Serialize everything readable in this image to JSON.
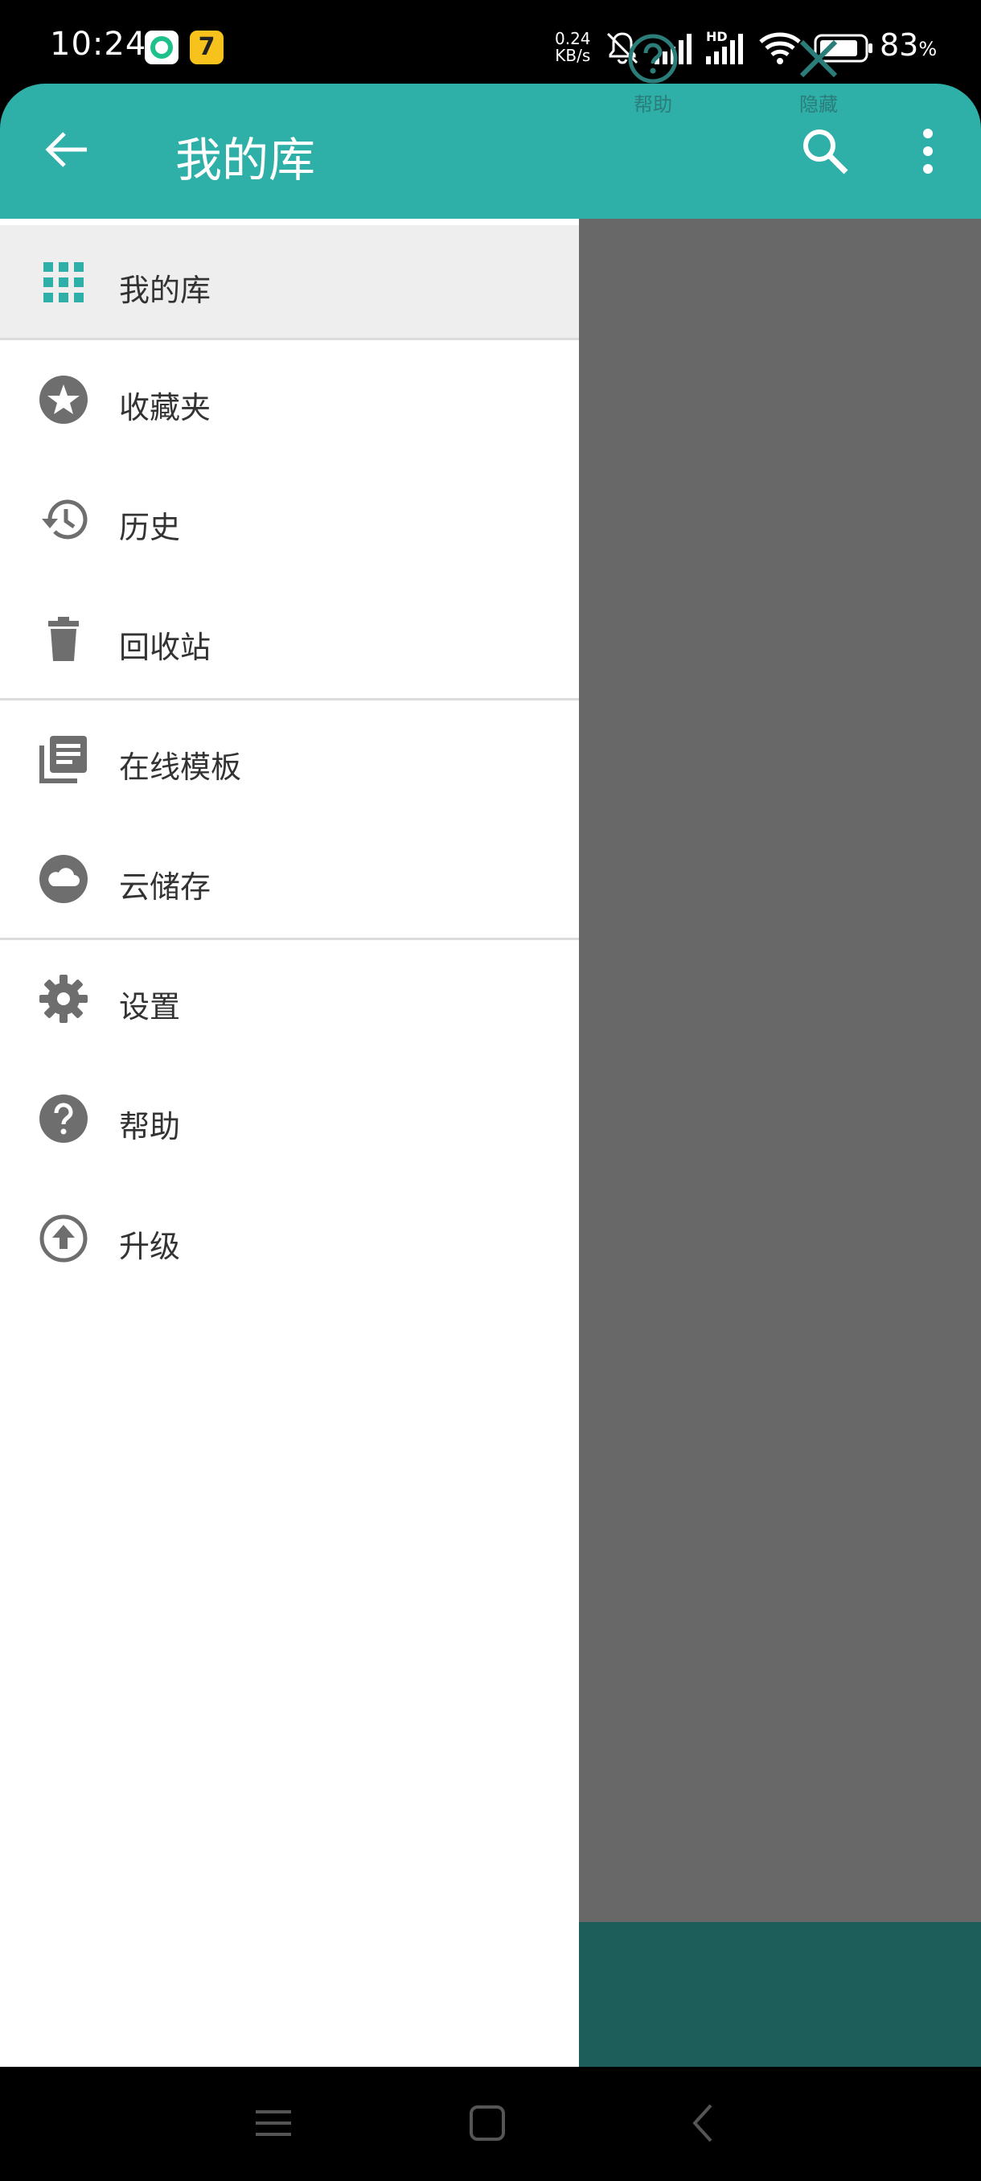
{
  "status_bar": {
    "time": "10:24",
    "net_speed_value": "0.24",
    "net_speed_unit": "KB/s",
    "hd_label": "HD",
    "battery_value": "83",
    "battery_unit": "%",
    "app_badge_2": "7"
  },
  "app_bar": {
    "title": "我的库"
  },
  "drawer": {
    "items": [
      {
        "label": "我的库",
        "icon": "grid-icon"
      },
      {
        "label": "收藏夹",
        "icon": "star-icon"
      },
      {
        "label": "历史",
        "icon": "history-icon"
      },
      {
        "label": "回收站",
        "icon": "trash-icon"
      },
      {
        "label": "在线模板",
        "icon": "library-icon"
      },
      {
        "label": "云储存",
        "icon": "cloud-icon"
      },
      {
        "label": "设置",
        "icon": "gear-icon"
      },
      {
        "label": "帮助",
        "icon": "help-icon"
      },
      {
        "label": "升级",
        "icon": "upgrade-icon"
      }
    ]
  },
  "bottom_panel": {
    "help_label": "帮助",
    "hide_label": "隐藏"
  },
  "colors": {
    "accent": "#2eafa8",
    "scrim": "#686868",
    "icon_gray": "#6e6e6e"
  }
}
